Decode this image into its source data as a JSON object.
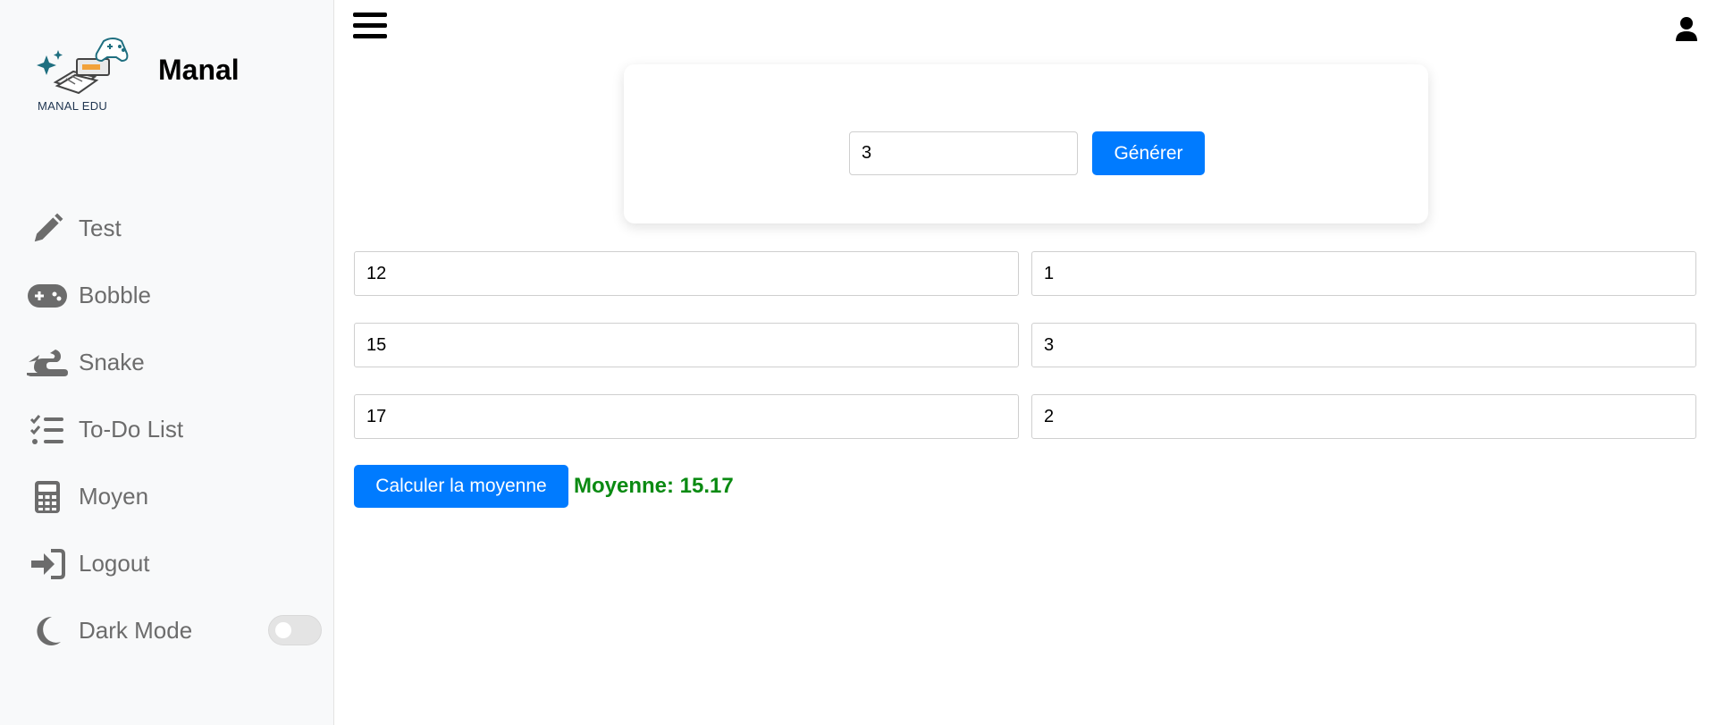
{
  "brand": {
    "name": "Manal",
    "logo_text": "MANAL EDU"
  },
  "sidebar": {
    "items": [
      {
        "label": "Test",
        "icon": "pencil-icon"
      },
      {
        "label": "Bobble",
        "icon": "gamepad-icon"
      },
      {
        "label": "Snake",
        "icon": "snake-icon"
      },
      {
        "label": "To-Do List",
        "icon": "checklist-icon"
      },
      {
        "label": "Moyen",
        "icon": "calculator-icon"
      },
      {
        "label": "Logout",
        "icon": "sign-in-icon"
      }
    ],
    "dark_mode": {
      "label": "Dark Mode",
      "icon": "moon-icon",
      "enabled": false
    }
  },
  "header": {
    "menu_icon": "hamburger-icon",
    "user_icon": "user-icon"
  },
  "generator": {
    "count_value": "3",
    "button_label": "Générer"
  },
  "grades": {
    "rows": [
      {
        "note": "12",
        "coef": "1"
      },
      {
        "note": "15",
        "coef": "3"
      },
      {
        "note": "17",
        "coef": "2"
      }
    ]
  },
  "average": {
    "button_label": "Calculer la moyenne",
    "result_text": "Moyenne: 15.17"
  },
  "colors": {
    "primary": "#007bff",
    "result": "#0a8a12",
    "nav_text": "#6c6c6c"
  }
}
